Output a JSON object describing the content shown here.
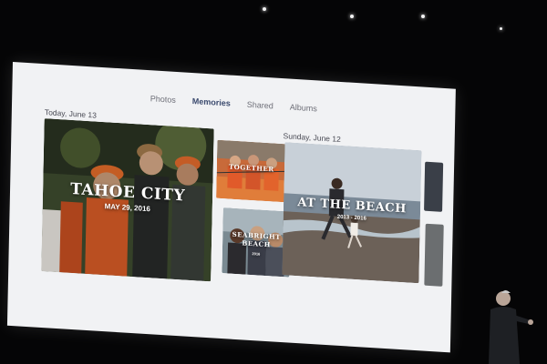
{
  "nav": {
    "tabs": [
      {
        "label": "Photos"
      },
      {
        "label": "Memories"
      },
      {
        "label": "Shared"
      },
      {
        "label": "Albums"
      }
    ]
  },
  "sections": {
    "today": {
      "label": "Today, June 13"
    },
    "sunday": {
      "label": "Sunday, June 12"
    }
  },
  "memories": {
    "tahoe": {
      "title": "TAHOE CITY",
      "date": "MAY 29, 2016"
    },
    "together": {
      "title": "TOGETHER",
      "date": ""
    },
    "seabright": {
      "title": "SEABRIGHT BEACH",
      "date": "2016"
    },
    "beach": {
      "title": "AT THE BEACH",
      "date": "2013 - 2016"
    }
  },
  "colors": {
    "screen_bg": "#f1f2f4",
    "accent": "#3b4a6e",
    "venue_bg": "#050506"
  }
}
